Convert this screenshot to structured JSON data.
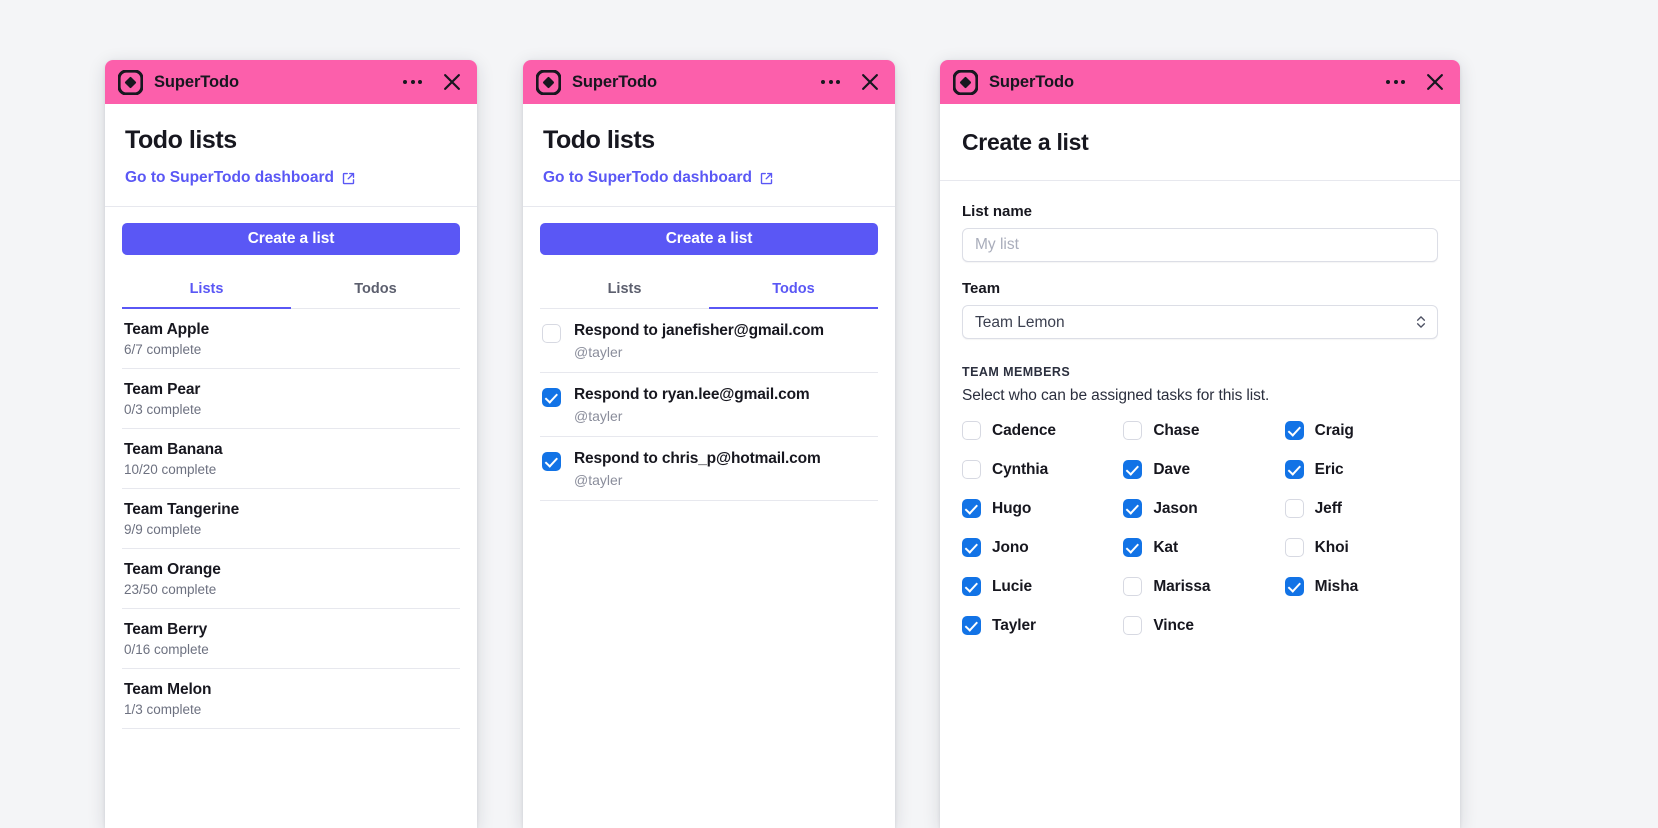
{
  "app": {
    "brand_name": "SuperTodo",
    "logo_icon": "supertodo-diamond-logo",
    "more_icon": "more-horizontal-icon",
    "close_icon": "close-icon",
    "accent_pink": "#fc5fab",
    "accent_indigo": "#5a57f5",
    "checkbox_blue": "#1273e6"
  },
  "panel_lists": {
    "title": "Todo lists",
    "dashboard_link": "Go to SuperTodo dashboard",
    "external_link_icon": "external-link-icon",
    "create_button": "Create a list",
    "tabs": [
      {
        "label": "Lists",
        "active": true
      },
      {
        "label": "Todos",
        "active": false
      }
    ],
    "rows": [
      {
        "title": "Team Apple",
        "sub": "6/7 complete"
      },
      {
        "title": "Team Pear",
        "sub": "0/3 complete"
      },
      {
        "title": "Team Banana",
        "sub": "10/20 complete"
      },
      {
        "title": "Team Tangerine",
        "sub": "9/9 complete"
      },
      {
        "title": "Team Orange",
        "sub": "23/50 complete"
      },
      {
        "title": "Team Berry",
        "sub": "0/16 complete"
      },
      {
        "title": "Team Melon",
        "sub": "1/3 complete"
      }
    ]
  },
  "panel_todos": {
    "title": "Todo lists",
    "dashboard_link": "Go to SuperTodo dashboard",
    "external_link_icon": "external-link-icon",
    "create_button": "Create a list",
    "tabs": [
      {
        "label": "Lists",
        "active": false
      },
      {
        "label": "Todos",
        "active": true
      }
    ],
    "todos": [
      {
        "title": "Respond to janefisher@gmail.com",
        "assignee": "@tayler",
        "checked": false
      },
      {
        "title": "Respond to ryan.lee@gmail.com",
        "assignee": "@tayler",
        "checked": true
      },
      {
        "title": "Respond to chris_p@hotmail.com",
        "assignee": "@tayler",
        "checked": true
      }
    ]
  },
  "panel_create": {
    "title": "Create a list",
    "list_name_label": "List name",
    "list_name_value": "",
    "list_name_placeholder": "My list",
    "team_label": "Team",
    "team_value": "Team Lemon",
    "team_options": [
      "Team Lemon"
    ],
    "select_chevron_icon": "chevron-up-down-icon",
    "members_heading": "TEAM MEMBERS",
    "members_description": "Select who can be assigned tasks for this list.",
    "members": [
      {
        "name": "Cadence",
        "checked": false
      },
      {
        "name": "Chase",
        "checked": false
      },
      {
        "name": "Craig",
        "checked": true
      },
      {
        "name": "Cynthia",
        "checked": false
      },
      {
        "name": "Dave",
        "checked": true
      },
      {
        "name": "Eric",
        "checked": true
      },
      {
        "name": "Hugo",
        "checked": true
      },
      {
        "name": "Jason",
        "checked": true
      },
      {
        "name": "Jeff",
        "checked": false
      },
      {
        "name": "Jono",
        "checked": true
      },
      {
        "name": "Kat",
        "checked": true
      },
      {
        "name": "Khoi",
        "checked": false
      },
      {
        "name": "Lucie",
        "checked": true
      },
      {
        "name": "Marissa",
        "checked": false
      },
      {
        "name": "Misha",
        "checked": true
      },
      {
        "name": "Tayler",
        "checked": true
      },
      {
        "name": "Vince",
        "checked": false
      }
    ]
  }
}
